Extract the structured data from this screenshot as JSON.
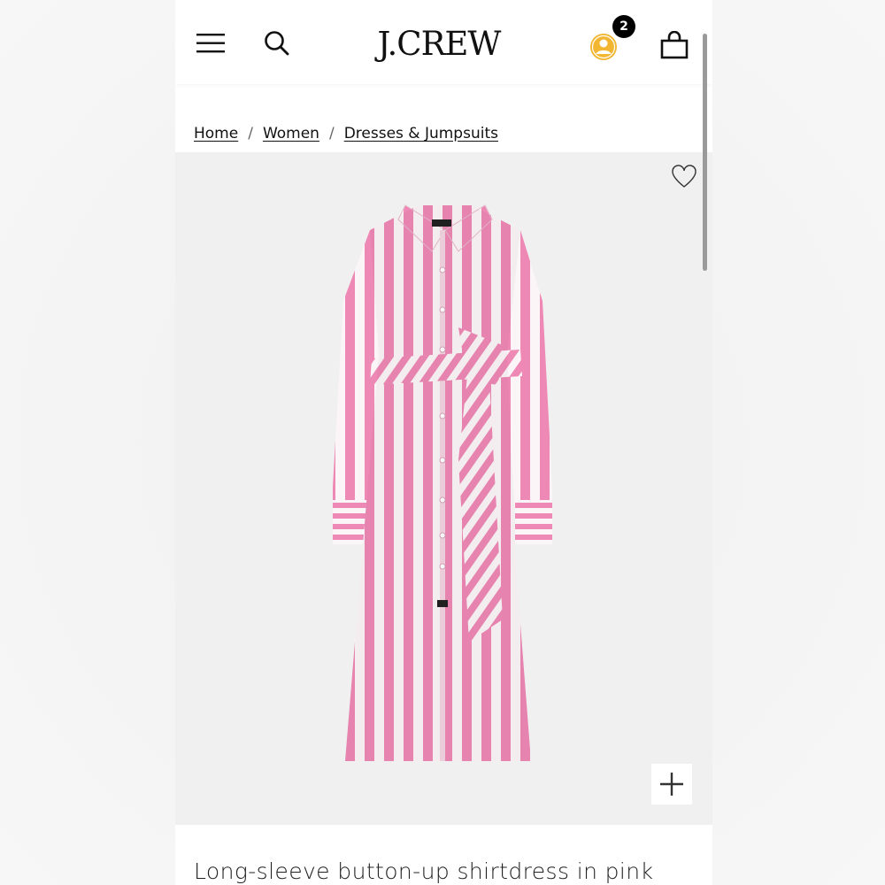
{
  "header": {
    "logo_text": "J.CREW",
    "cart_badge_count": "2",
    "icons": [
      "menu-icon",
      "search-icon",
      "account-icon",
      "shopping-bag-icon"
    ],
    "account_icon_color": "#f2b632"
  },
  "breadcrumb": {
    "items": [
      {
        "label": "Home"
      },
      {
        "label": "Women"
      },
      {
        "label": "Dresses & Jumpsuits"
      }
    ],
    "separator": "/"
  },
  "product": {
    "image_icons": [
      "heart-icon",
      "plus-icon"
    ],
    "stripe_color": "#ee88b4",
    "title": "Long-sleeve button-up shirtdress in pink"
  }
}
